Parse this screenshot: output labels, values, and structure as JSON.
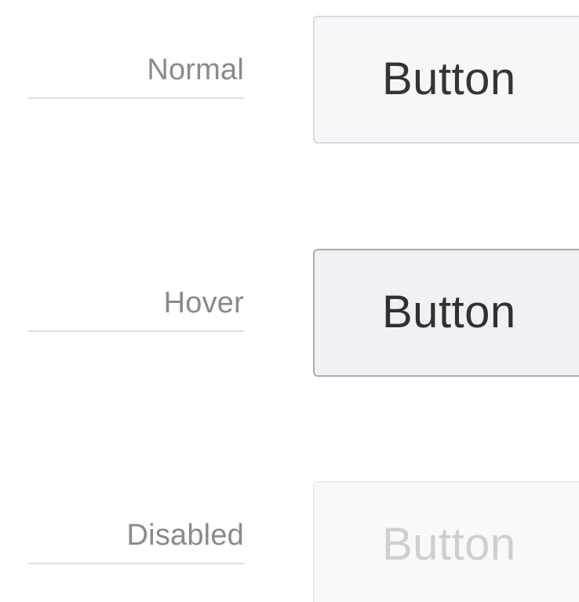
{
  "states": {
    "normal": {
      "label": "Normal",
      "button_label": "Button"
    },
    "hover": {
      "label": "Hover",
      "button_label": "Button"
    },
    "disabled": {
      "label": "Disabled",
      "button_label": "Button"
    }
  },
  "colors": {
    "label_text": "#8a8a8a",
    "divider": "#dedede",
    "button_text": "#353535",
    "button_bg": "#f6f7f9",
    "button_border": "#d9dadd",
    "hover_border": "#a8abb5",
    "disabled_text": "#cfcfd2"
  }
}
